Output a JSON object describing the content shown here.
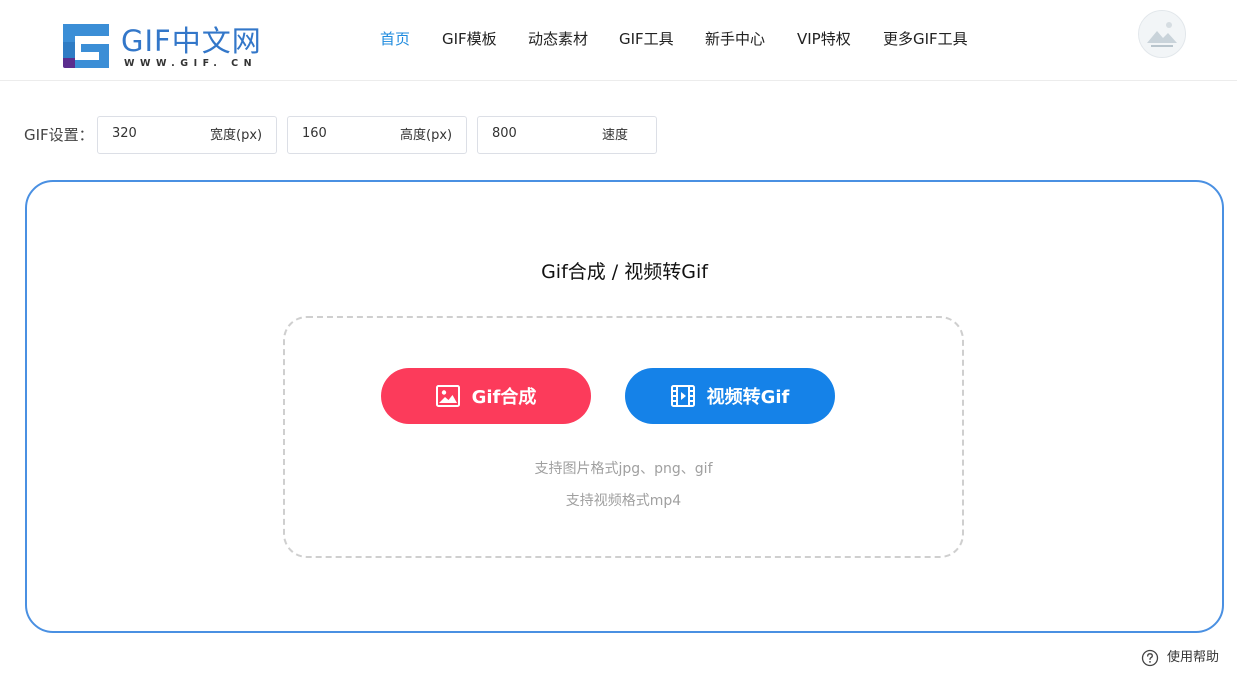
{
  "logo": {
    "text": "GIF中文网",
    "subtext": "WWW.GIF. CN"
  },
  "nav": {
    "items": [
      {
        "label": "首页",
        "active": true
      },
      {
        "label": "GIF模板",
        "active": false
      },
      {
        "label": "动态素材",
        "active": false
      },
      {
        "label": "GIF工具",
        "active": false
      },
      {
        "label": "新手中心",
        "active": false
      },
      {
        "label": "VIP特权",
        "active": false
      },
      {
        "label": "更多GIF工具",
        "active": false
      }
    ]
  },
  "settings": {
    "label": "GIF设置：",
    "width": {
      "value": "320",
      "unit": "宽度(px)"
    },
    "height": {
      "value": "160",
      "unit": "高度(px)"
    },
    "speed": {
      "value": "800",
      "unit": "速度"
    }
  },
  "main": {
    "title": "Gif合成 / 视频转Gif",
    "gif_button": "Gif合成",
    "video_button": "视频转Gif",
    "hint_images": "支持图片格式jpg、png、gif",
    "hint_video": "支持视频格式mp4"
  },
  "help": {
    "label": "使用帮助"
  },
  "colors": {
    "accent_blue": "#1582e8",
    "accent_red": "#fc3b5b",
    "card_border": "#4a90e2",
    "nav_active": "#1f8bde"
  },
  "icons": [
    "logo-mark-icon",
    "avatar-icon",
    "image-icon",
    "film-icon",
    "question-circle-icon"
  ]
}
